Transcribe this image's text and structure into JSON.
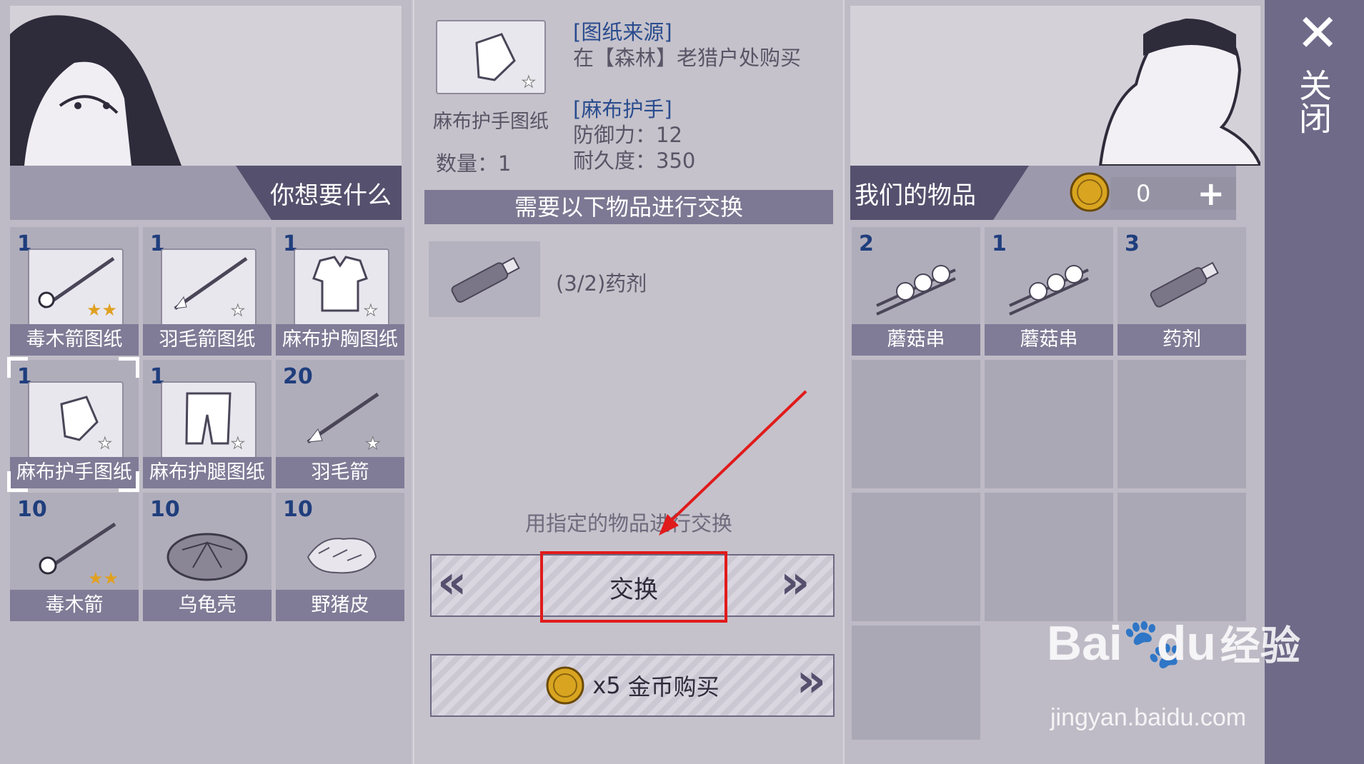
{
  "left": {
    "header": "你想要什么",
    "items": [
      {
        "count": "1",
        "label": "毒木箭图纸",
        "icon": "poison-arrow-blueprint"
      },
      {
        "count": "1",
        "label": "羽毛箭图纸",
        "icon": "feather-arrow-blueprint"
      },
      {
        "count": "1",
        "label": "麻布护胸图纸",
        "icon": "cloth-chest-blueprint"
      },
      {
        "count": "1",
        "label": "麻布护手图纸",
        "icon": "cloth-glove-blueprint"
      },
      {
        "count": "1",
        "label": "麻布护腿图纸",
        "icon": "cloth-leg-blueprint"
      },
      {
        "count": "20",
        "label": "羽毛箭",
        "icon": "feather-arrow"
      },
      {
        "count": "10",
        "label": "毒木箭",
        "icon": "poison-arrow"
      },
      {
        "count": "10",
        "label": "乌龟壳",
        "icon": "turtle-shell"
      },
      {
        "count": "10",
        "label": "野猪皮",
        "icon": "boar-hide"
      }
    ]
  },
  "detail": {
    "item_name": "麻布护手图纸",
    "quantity": "数量：1",
    "source_title": "[图纸来源]",
    "source_text": "在【森林】老猎户处购买",
    "product_title": "[麻布护手]",
    "defense": "防御力：12",
    "durability": "耐久度：350",
    "exchange_header": "需要以下物品进行交换",
    "required_item": "(3/2)药剂",
    "hint": "用指定的物品进行交换",
    "exchange_button": "交换",
    "prev_arrow": "«",
    "next_arrow": "»",
    "buy_multiplier": "x5",
    "buy_label": "金币购买"
  },
  "right": {
    "header": "我们的物品",
    "coins": "0",
    "add_label": "+",
    "items": [
      {
        "count": "2",
        "label": "蘑菇串",
        "icon": "mushroom-skewer"
      },
      {
        "count": "1",
        "label": "蘑菇串",
        "icon": "mushroom-skewer"
      },
      {
        "count": "3",
        "label": "药剂",
        "icon": "potion"
      }
    ]
  },
  "close_label": "关闭",
  "watermark": {
    "brand": "Bai",
    "brand2": "du",
    "cn": "经验",
    "url": "jingyan.baidu.com"
  }
}
